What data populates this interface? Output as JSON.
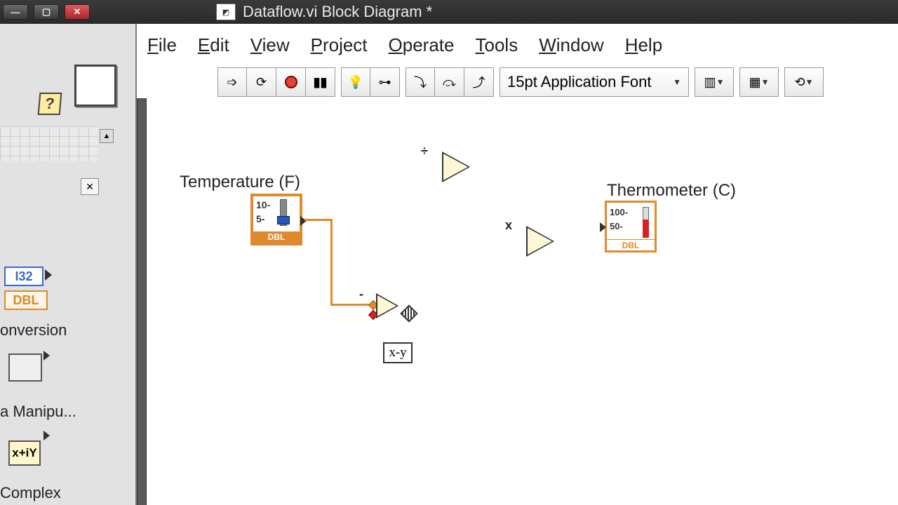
{
  "window": {
    "title": "Dataflow.vi Block Diagram *"
  },
  "menu": {
    "items": [
      "File",
      "Edit",
      "View",
      "Project",
      "Operate",
      "Tools",
      "Window",
      "Help"
    ]
  },
  "toolbar": {
    "font": "15pt Application Font"
  },
  "palette": {
    "i32": "I32",
    "dbl": "DBL",
    "conversion": "onversion",
    "manipulation": "a Manipu...",
    "xy": "x+iY",
    "complex": "Complex"
  },
  "canvas": {
    "temp_label": "Temperature (F)",
    "therm_label": "Thermometer (C)",
    "ctrl_tick1": "10-",
    "ctrl_tick2": "5-",
    "ctrl_type": "DBL",
    "ind_tick1": "100-",
    "ind_tick2": "50-",
    "ind_type": "DBL",
    "div_sym": "÷",
    "mul_sym": "x",
    "sub_sym": "-",
    "expr": "x-y"
  }
}
